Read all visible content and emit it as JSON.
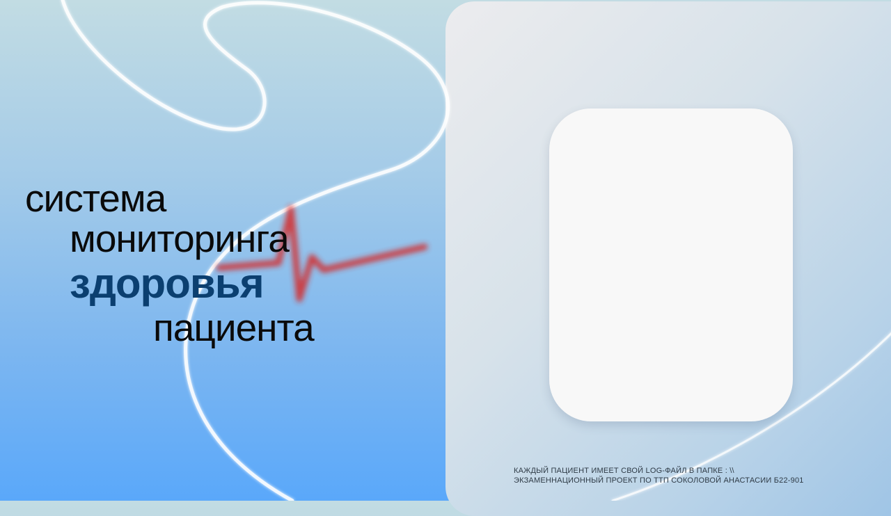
{
  "slide": {
    "title_lines": [
      "система",
      "мониторинга",
      "здоровья",
      "пациента"
    ],
    "footer_lines": [
      "КАЖДЫЙ ПАЦИЕНТ ИМЕЕТ СВОЙ LOG-ФАЙЛ В ПАПКЕ : \\\\",
      "ЭКЗАМЕННАЦИОННЫЙ ПРОЕКТ ПО ТТП СОКОЛОВОЙ АНАСТАСИИ Б22-901"
    ]
  },
  "colors": {
    "title_text": "#0a0a0a",
    "accent_word": "#0b3f70",
    "heartbeat": "#d42a2a",
    "card": "#f8f8f8"
  },
  "icons": {
    "decorative_curve": "white-wave-line",
    "heartbeat": "heartbeat-pulse-icon"
  }
}
